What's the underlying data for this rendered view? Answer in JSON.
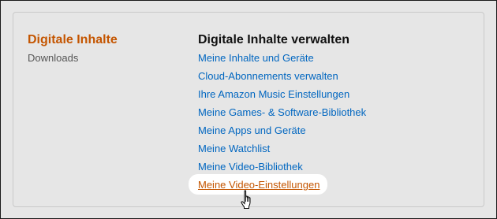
{
  "sidebar": {
    "title": "Digitale Inhalte",
    "subtitle": "Downloads"
  },
  "main": {
    "heading": "Digitale Inhalte verwalten",
    "links": [
      "Meine Inhalte und Geräte",
      "Cloud-Abonnements verwalten",
      "Ihre Amazon Music Einstellungen",
      "Meine Games- & Software-Bibliothek",
      "Meine Apps und Geräte",
      "Meine Watchlist",
      "Meine Video-Bibliothek",
      "Meine Video-Einstellungen"
    ],
    "active_link_index": 7
  },
  "colors": {
    "accent": "#c45500",
    "link": "#0066c0",
    "background": "#e6e6e6"
  },
  "icons": {
    "cursor": "hand-pointer-icon"
  }
}
